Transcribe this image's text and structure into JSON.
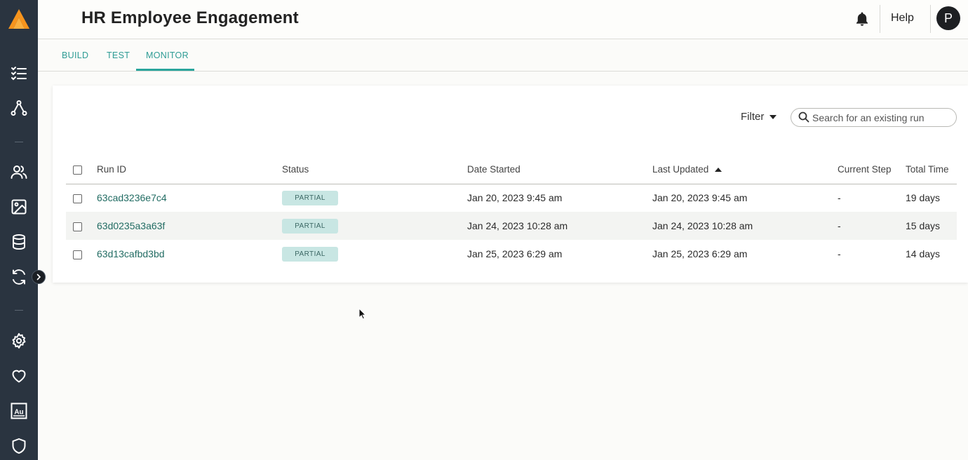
{
  "header": {
    "title": "HR Employee Engagement",
    "help_label": "Help",
    "avatar_initial": "P"
  },
  "tabs": [
    {
      "label": "BUILD",
      "active": false
    },
    {
      "label": "TEST",
      "active": false
    },
    {
      "label": "MONITOR",
      "active": true
    }
  ],
  "toolbar": {
    "filter_label": "Filter",
    "search_placeholder": "Search for an existing run"
  },
  "table": {
    "columns": [
      "Run ID",
      "Status",
      "Date Started",
      "Last Updated",
      "Current Step",
      "Total Time"
    ],
    "sorted_column": "Last Updated",
    "sort_direction": "ascending",
    "rows": [
      {
        "run_id": "63cad3236e7c4",
        "status": "PARTIAL",
        "date_started": "Jan 20, 2023 9:45 am",
        "last_updated": "Jan 20, 2023 9:45 am",
        "current_step": "-",
        "total_time": "19 days"
      },
      {
        "run_id": "63d0235a3a63f",
        "status": "PARTIAL",
        "date_started": "Jan 24, 2023 10:28 am",
        "last_updated": "Jan 24, 2023 10:28 am",
        "current_step": "-",
        "total_time": "15 days"
      },
      {
        "run_id": "63d13cafbd3bd",
        "status": "PARTIAL",
        "date_started": "Jan 25, 2023 6:29 am",
        "last_updated": "Jan 25, 2023 6:29 am",
        "current_step": "-",
        "total_time": "14 days"
      }
    ]
  },
  "sidebar": {
    "icons": [
      "checklist-icon",
      "workflow-icon",
      "users-icon",
      "image-icon",
      "database-icon",
      "sync-icon",
      "settings-icon",
      "heart-icon",
      "au-icon",
      "shield-icon"
    ]
  },
  "colors": {
    "sidebar_bg": "#2a3440",
    "accent": "#2aa59c",
    "link": "#226c63",
    "badge_bg": "#c8e6e3",
    "logo_orange": "#f7941d"
  }
}
